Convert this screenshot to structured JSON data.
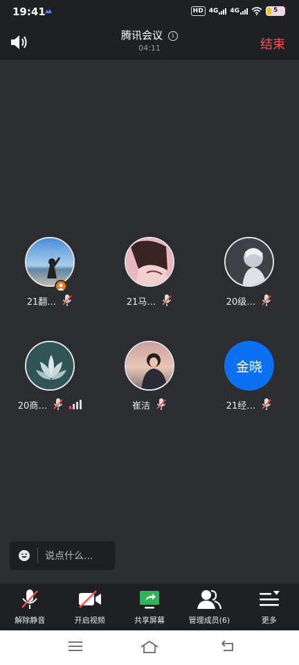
{
  "status_bar": {
    "time": "19:41",
    "hd": "HD",
    "net1": "4G",
    "net2": "4G",
    "battery": "5"
  },
  "header": {
    "title": "腾讯会议",
    "timer": "04:11",
    "end_label": "结束"
  },
  "participants": [
    {
      "name": "21翻…",
      "avatar": "photo-beach-girl",
      "host": true,
      "mic": "muted"
    },
    {
      "name": "21马…",
      "avatar": "photo-anime-boy",
      "mic": "muted"
    },
    {
      "name": "20级…",
      "avatar": "photo-anime-gray",
      "mic": "muted"
    },
    {
      "name": "20商…",
      "avatar": "photo-glass-flower",
      "mic": "muted",
      "signal": "weak"
    },
    {
      "name": "崔洁",
      "avatar": "photo-sunset-girl",
      "mic": "muted"
    },
    {
      "name": "21经…",
      "avatar_text": "金晓",
      "mic": "muted"
    }
  ],
  "chat": {
    "placeholder": "说点什么..."
  },
  "toolbar": {
    "unmute": "解除静音",
    "video": "开启视频",
    "share": "共享屏幕",
    "members": "管理成员(6)",
    "more": "更多"
  },
  "colors": {
    "accent_blue": "#0c70f2",
    "end_red": "#ff4d4f",
    "muted_red": "#ff4d4f",
    "share_green": "#2fb35b",
    "background": "#2b2d31"
  }
}
